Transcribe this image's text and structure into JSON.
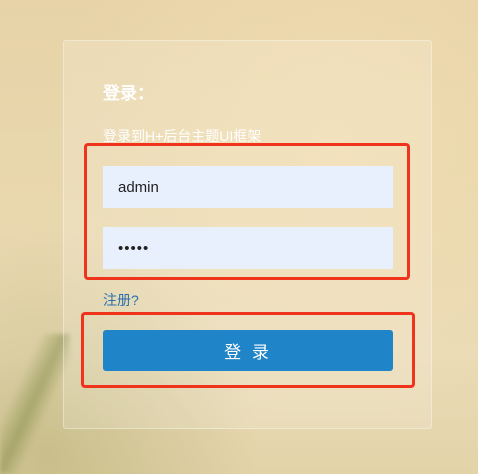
{
  "login": {
    "title": "登录：",
    "subtitle": "登录到H+后台主题UI框架",
    "username_value": "admin",
    "password_value": "admin",
    "register_link": "注册?",
    "login_button": "登 录"
  },
  "colors": {
    "button": "#1f84c8",
    "input_bg": "#e8f0fe",
    "highlight_border": "#f0331d",
    "link": "#2a6fb0"
  }
}
